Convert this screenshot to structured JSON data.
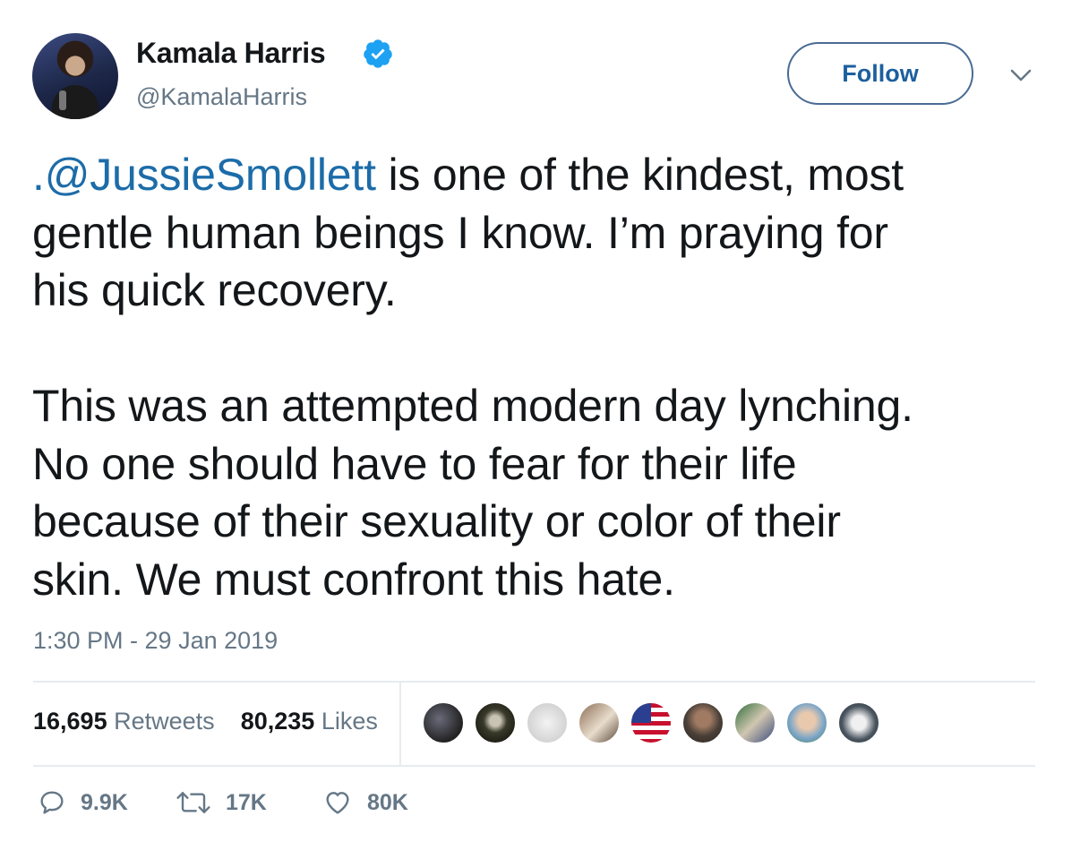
{
  "author": {
    "name": "Kamala Harris",
    "handle": "@KamalaHarris",
    "verified": true
  },
  "header": {
    "follow_label": "Follow",
    "menu_icon": "chevron-down-icon"
  },
  "tweet": {
    "mention": ".@JussieSmollett",
    "text_after_mention": " is one of the kindest, most\ngentle human beings I know. I’m praying for\nhis quick recovery.\n\nThis was an attempted modern day lynching.\nNo one should have to fear for their life\nbecause of their sexuality or color of their\nskin. We must confront this hate.",
    "timestamp": "1:30 PM - 29 Jan 2019"
  },
  "stats": {
    "retweets_count": "16,695",
    "retweets_label": "Retweets",
    "likes_count": "80,235",
    "likes_label": "Likes"
  },
  "actions": {
    "reply_count": "9.9K",
    "retweet_count": "17K",
    "like_count": "80K"
  },
  "colors": {
    "accent": "#1c6ca8",
    "verified_badge": "#1da1f2",
    "muted_text": "#657786",
    "divider": "#e6ecf0"
  }
}
